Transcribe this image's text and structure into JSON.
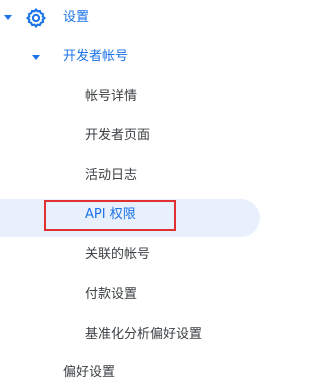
{
  "nav": {
    "settings": {
      "label": "设置",
      "icon": "gear-icon",
      "expanded": true
    },
    "developer_account": {
      "label": "开发者帐号",
      "expanded": true,
      "children": [
        {
          "label": "帐号详情"
        },
        {
          "label": "开发者页面"
        },
        {
          "label": "活动日志"
        },
        {
          "label": "API 权限",
          "active": true
        },
        {
          "label": "关联的帐号"
        },
        {
          "label": "付款设置"
        },
        {
          "label": "基准化分析偏好设置"
        }
      ]
    },
    "preferences": {
      "label": "偏好设置"
    }
  },
  "colors": {
    "accent": "#1a73e8",
    "active_background": "#e8f0fe",
    "highlight_box": "#e03131",
    "text": "#3c4043"
  }
}
